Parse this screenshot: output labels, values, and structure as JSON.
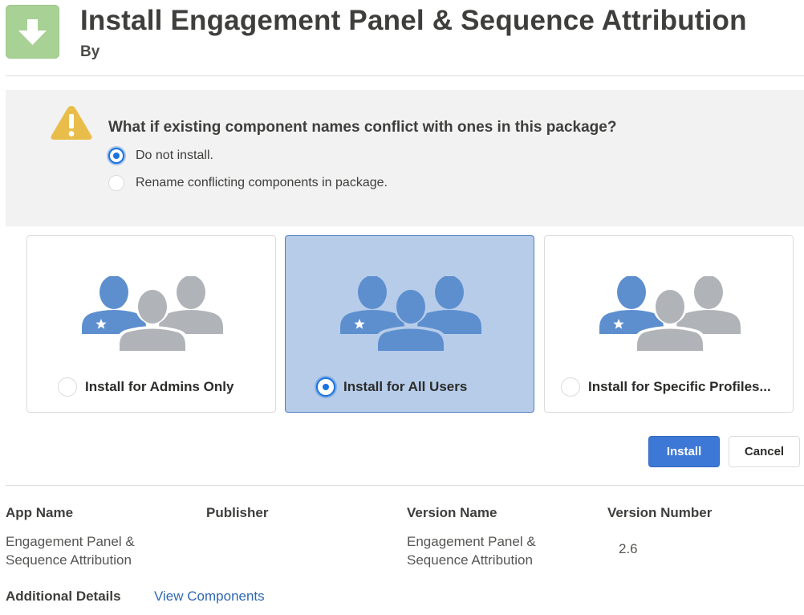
{
  "header": {
    "title": "Install Engagement Panel & Sequence Attribution",
    "by_label": "By",
    "icon": "download-arrow-icon"
  },
  "conflict": {
    "question": "What if existing component names conflict with ones in this package?",
    "options": [
      {
        "label": "Do not install.",
        "selected": true
      },
      {
        "label": "Rename conflicting components in package.",
        "selected": false
      }
    ],
    "icon": "warning-icon"
  },
  "install_options": [
    {
      "label": "Install for Admins Only",
      "selected": false,
      "icon": "users-icon"
    },
    {
      "label": "Install for All Users",
      "selected": true,
      "icon": "users-icon"
    },
    {
      "label": "Install for Specific Profiles...",
      "selected": false,
      "icon": "users-icon"
    }
  ],
  "buttons": {
    "install": "Install",
    "cancel": "Cancel"
  },
  "details": {
    "headers": [
      "App Name",
      "Publisher",
      "Version Name",
      "Version Number"
    ],
    "app_name_lines": [
      "Engagement Panel &",
      "Sequence Attribution"
    ],
    "publisher": "",
    "version_name_lines": [
      "Engagement Panel &",
      "Sequence Attribution"
    ],
    "version_number": "2.6",
    "additional_details_label": "Additional Details",
    "view_components_link": "View Components"
  },
  "colors": {
    "brand_blue": "#3d78d6",
    "selected_card_bg": "#b6cce9",
    "app_icon_bg": "#a8d195",
    "warning_yellow": "#e9bd4a",
    "person_blue": "#5d8fcf",
    "person_gray": "#b0b3b8",
    "link_blue": "#2f68b3"
  }
}
